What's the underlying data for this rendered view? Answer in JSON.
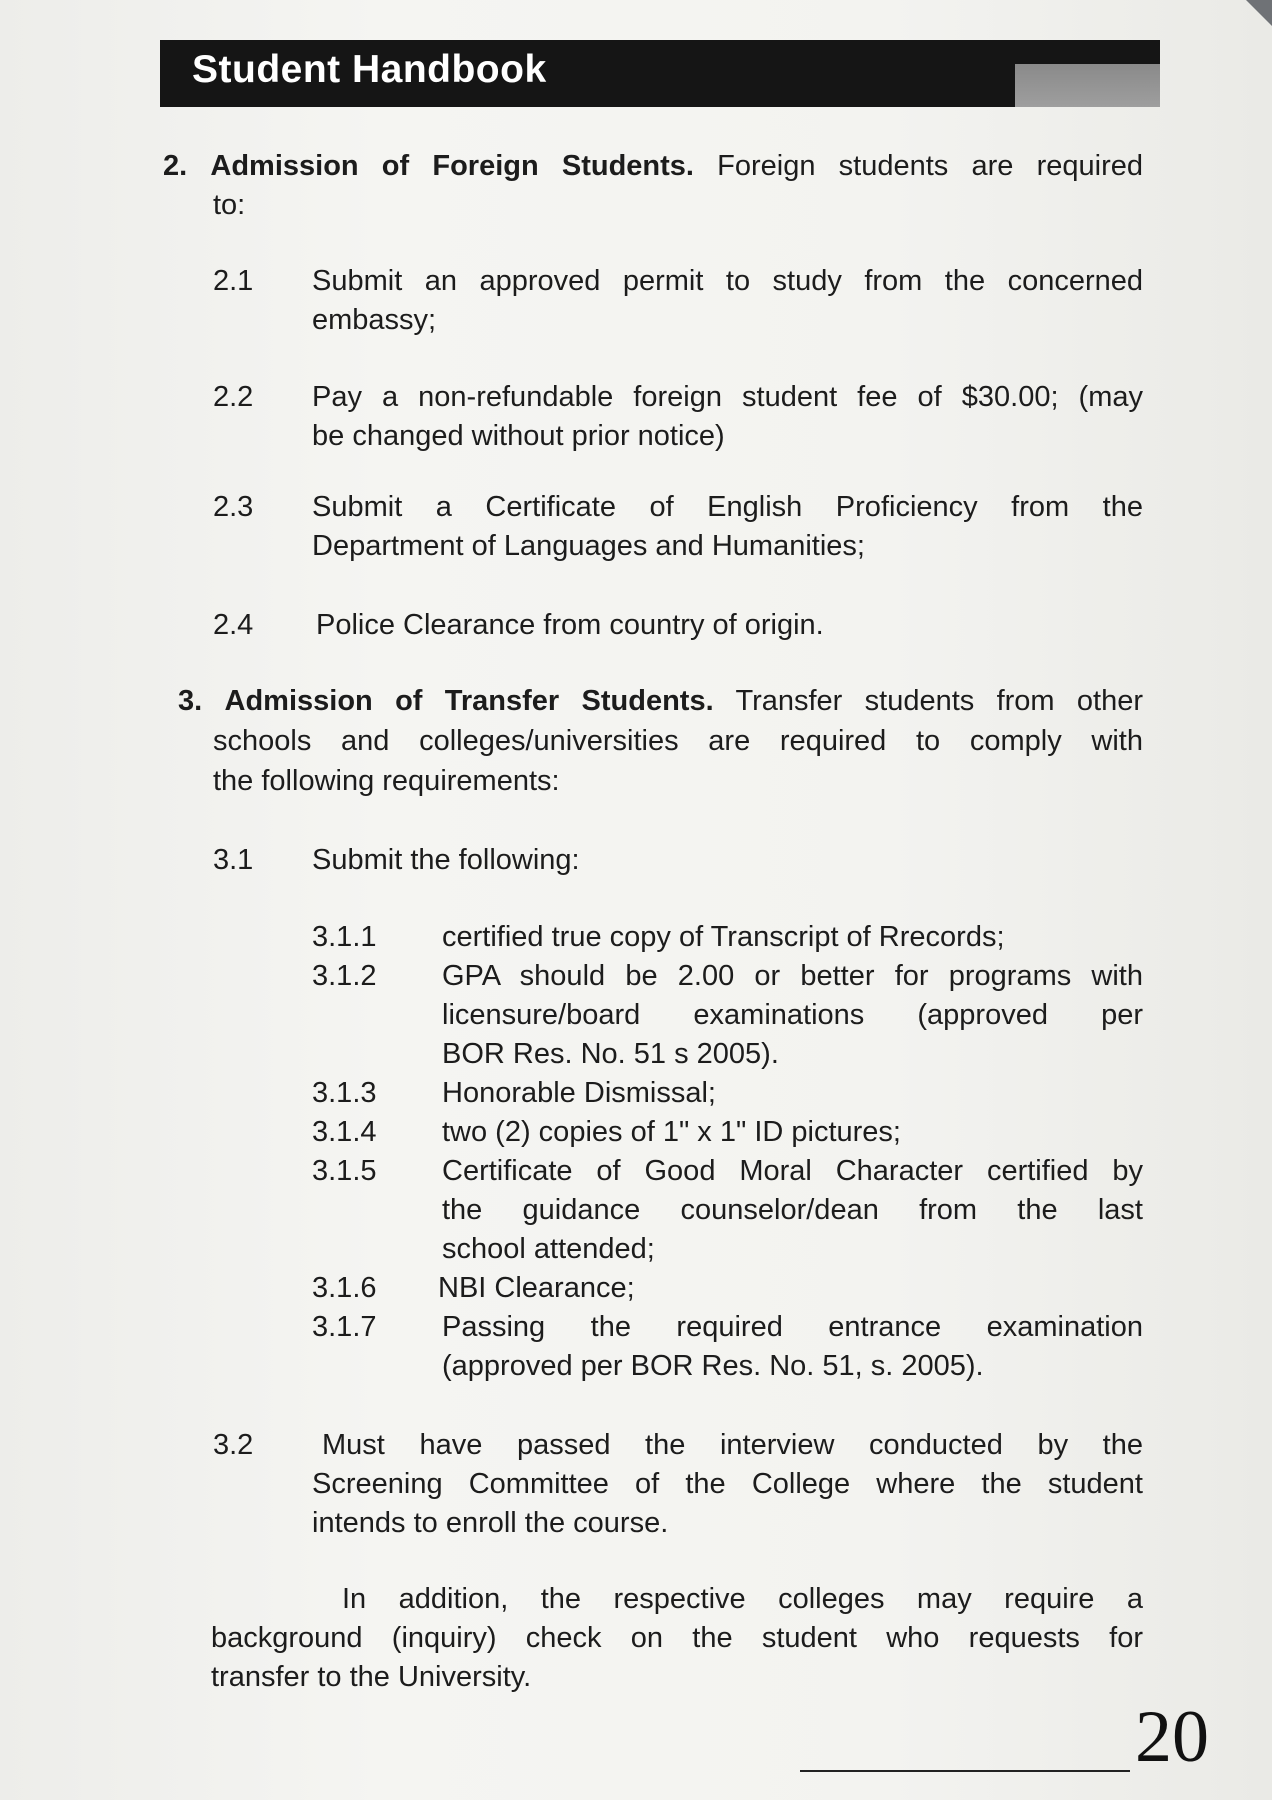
{
  "header": {
    "title": "Student Handbook"
  },
  "section2": {
    "number": "2.",
    "heading": "Admission of Foreign Students.",
    "intro_line1": "Foreign students are required",
    "intro_line2": "to:",
    "items": [
      {
        "num": "2.1",
        "line1": "Submit an approved permit to study from the concerned",
        "line2": "embassy;"
      },
      {
        "num": "2.2",
        "line1": "Pay a non-refundable foreign student fee of $30.00; (may",
        "line2": "be changed without prior notice)"
      },
      {
        "num": "2.3",
        "line1": "Submit a Certificate of English Proficiency from the",
        "line2": "Department of Languages and Humanities;"
      },
      {
        "num": "2.4",
        "line1": "Police Clearance from country of origin."
      }
    ]
  },
  "section3": {
    "number": "3.",
    "heading": "Admission of Transfer Students.",
    "intro_line1": "Transfer students from other",
    "intro_line2": "schools and colleges/universities are required to comply with",
    "intro_line3": "the following requirements:",
    "item1": {
      "num": "3.1",
      "text": "Submit the following:",
      "subitems": [
        {
          "num": "3.1.1",
          "lines": [
            "certified true copy of Transcript of Rrecords;"
          ]
        },
        {
          "num": "3.1.2",
          "lines": [
            "GPA  should be 2.00 or better for programs with",
            "licensure/board examinations (approved per",
            "BOR Res. No. 51 s 2005)."
          ]
        },
        {
          "num": "3.1.3",
          "lines": [
            "Honorable Dismissal;"
          ]
        },
        {
          "num": "3.1.4",
          "lines": [
            "two (2) copies of 1\" x 1\" ID pictures;"
          ]
        },
        {
          "num": "3.1.5",
          "lines": [
            "Certificate of Good Moral Character certified by",
            "the guidance counselor/dean from the last",
            "school attended;"
          ]
        },
        {
          "num": "3.1.6",
          "lines": [
            "NBI Clearance;"
          ]
        },
        {
          "num": "3.1.7",
          "lines": [
            "Passing the required entrance examination",
            "(approved per BOR Res. No. 51, s. 2005)."
          ]
        }
      ]
    },
    "item2": {
      "num": "3.2",
      "line1": "Must have passed the interview conducted by the",
      "line2": "Screening Committee of the College where the student",
      "line3": "intends to enroll the course."
    },
    "addition": {
      "line1": "In addition, the respective colleges may require a",
      "line2": "background (inquiry) check on the student who requests for",
      "line3": "transfer to the University."
    }
  },
  "footer": {
    "page_number": "20"
  }
}
